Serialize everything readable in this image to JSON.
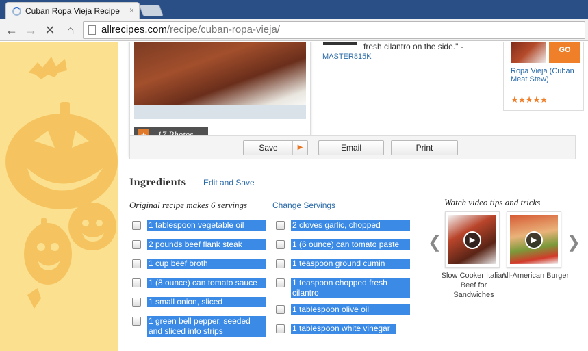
{
  "browser": {
    "tab_title": "Cuban Ropa Vieja Recipe -",
    "tab_close": "×",
    "url_host": "allrecipes.com",
    "url_path": "/recipe/cuban-ropa-vieja/"
  },
  "photo": {
    "badge_plus": "+",
    "count_label": "17 Photos"
  },
  "review": {
    "text": "fresh cilantro on the side.\" -",
    "author": "MASTER815K"
  },
  "recommended": {
    "go_label": "GO",
    "title": "Ropa Vieja (Cuban Meat Stew)",
    "stars": "★★★★★",
    "rating": 5
  },
  "actions": {
    "save": "Save",
    "email": "Email",
    "print": "Print"
  },
  "ingredients": {
    "heading": "Ingredients",
    "edit_link": "Edit and Save",
    "servings_text": "Original recipe makes 6 servings",
    "change_link": "Change Servings",
    "left": [
      "1 tablespoon vegetable oil",
      "2 pounds beef flank steak",
      "1 cup beef broth",
      "1 (8 ounce) can tomato sauce",
      "1 small onion, sliced",
      "1 green bell pepper, seeded and sliced into strips"
    ],
    "right": [
      "2 cloves garlic, chopped",
      "1 (6 ounce) can tomato paste",
      "1 teaspoon ground cumin",
      "1 teaspoon chopped fresh cilantro",
      "1 tablespoon olive oil",
      "1 tablespoon white vinegar"
    ]
  },
  "videos": {
    "heading": "Watch video tips and tricks",
    "items": [
      {
        "caption": "Slow Cooker Italian Beef for Sandwiches"
      },
      {
        "caption": "All-American Burger"
      }
    ]
  },
  "colors": {
    "accent_orange": "#f07f2a",
    "link_blue": "#2a6aa8",
    "selection_blue": "#3b8be6",
    "sidebar_yellow": "#fbe08f"
  }
}
